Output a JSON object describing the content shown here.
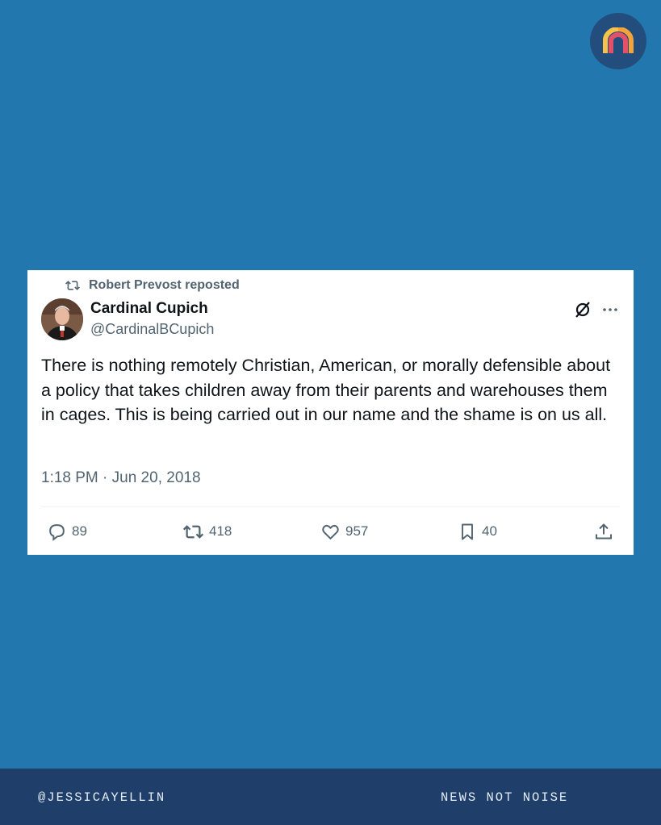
{
  "brand": {
    "logo_icon": "rainbow-arch-logo-icon",
    "background_color": "#2278ae",
    "logo_bg_color": "#234d7c"
  },
  "tweet": {
    "repost_text": "Robert Prevost reposted",
    "author_name": "Cardinal Cupich",
    "author_handle": "@CardinalBCupich",
    "body": "There is nothing remotely Christian, American, or morally defensible about a policy that takes children away from their parents and warehouses them in cages. This is being carried out in our name and the shame is on us all.",
    "timestamp": "1:18 PM · Jun 20, 2018",
    "actions": {
      "replies": "89",
      "reposts": "418",
      "likes": "957",
      "bookmarks": "40"
    }
  },
  "footer": {
    "handle": "@JESSICAYELLIN",
    "tagline": "NEWS NOT NOISE"
  }
}
